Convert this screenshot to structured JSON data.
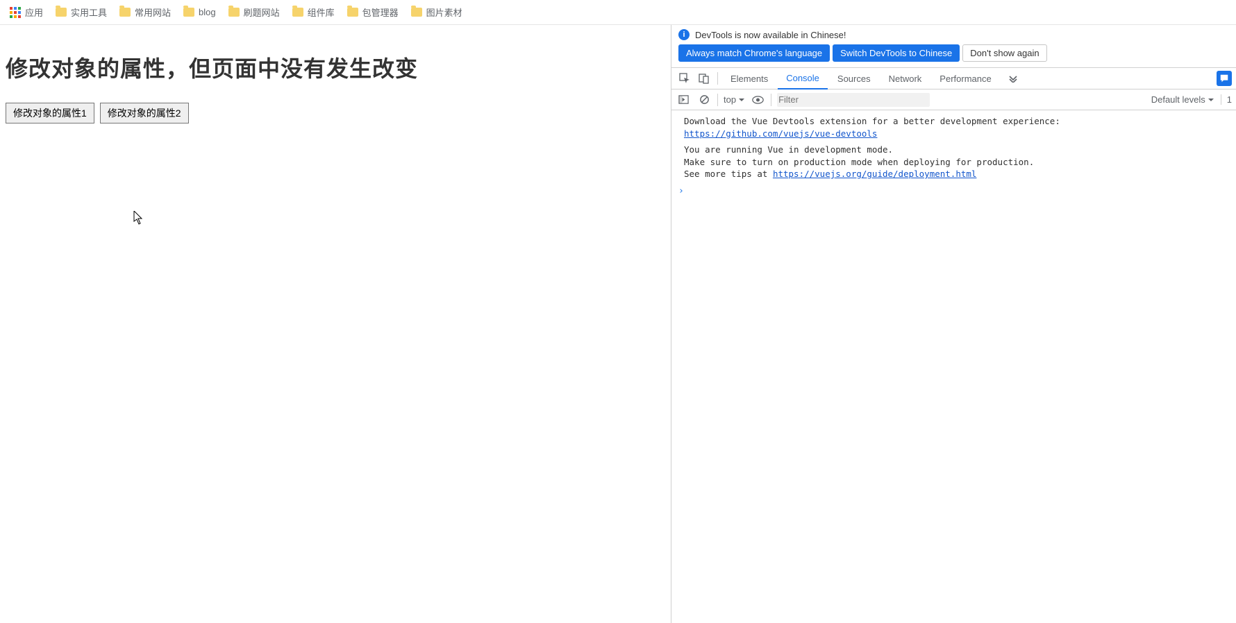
{
  "bookmarks": {
    "apps": "应用",
    "items": [
      "实用工具",
      "常用网站",
      "blog",
      "刷题网站",
      "组件库",
      "包管理器",
      "图片素材"
    ]
  },
  "page": {
    "title": "修改对象的属性，但页面中没有发生改变",
    "button1": "修改对象的属性1",
    "button2": "修改对象的属性2"
  },
  "devtools": {
    "banner_text": "DevTools is now available in Chinese!",
    "btn_match": "Always match Chrome's language",
    "btn_switch": "Switch DevTools to Chinese",
    "btn_dont": "Don't show again",
    "tabs": [
      "Elements",
      "Console",
      "Sources",
      "Network",
      "Performance"
    ],
    "active_tab": "Console",
    "console_toolbar": {
      "context": "top",
      "filter_placeholder": "Filter",
      "levels": "Default levels",
      "hidden_count": "1"
    },
    "console_messages": {
      "m1_line1": "Download the Vue Devtools extension for a better development experience:",
      "m1_link": "https://github.com/vuejs/vue-devtools",
      "m2_line1": "You are running Vue in development mode.",
      "m2_line2": "Make sure to turn on production mode when deploying for production.",
      "m2_line3_prefix": "See more tips at ",
      "m2_link": "https://vuejs.org/guide/deployment.html"
    },
    "prompt": "›"
  }
}
